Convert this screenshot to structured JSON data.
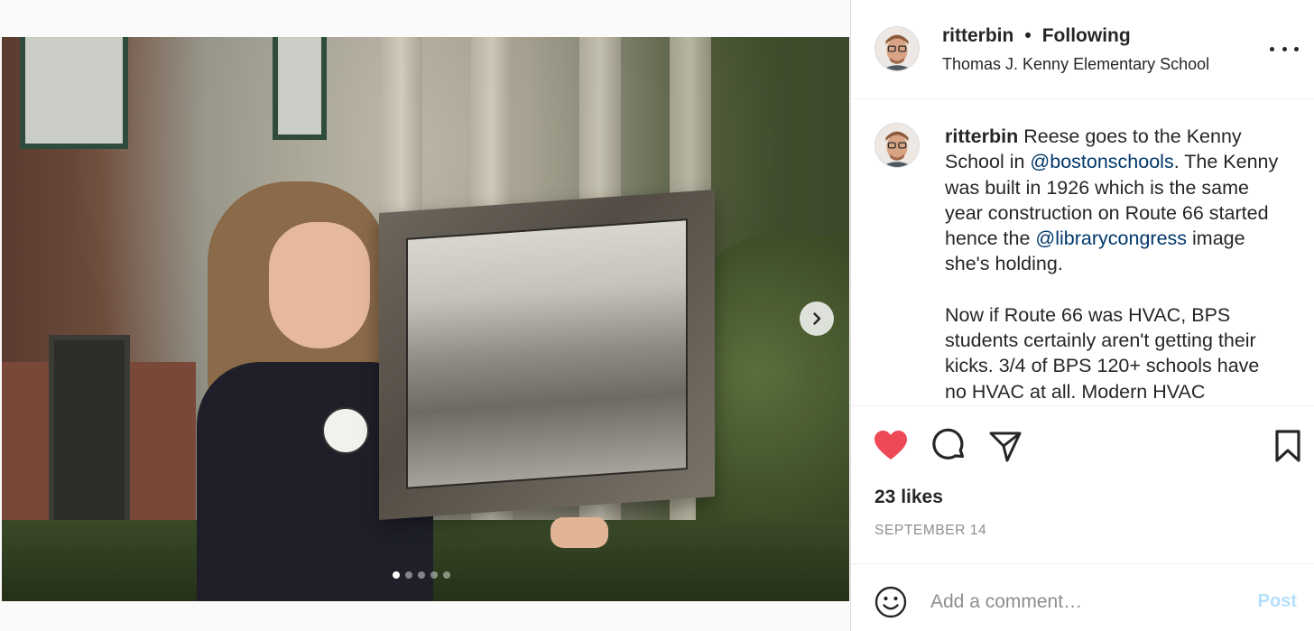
{
  "post": {
    "username": "ritterbin",
    "separator": "•",
    "follow_status": "Following",
    "location": "Thomas J. Kenny Elementary School",
    "caption": {
      "username": "ritterbin",
      "p1_a": " Reese goes to the Kenny School in ",
      "mention1": "@bostonschools",
      "p1_b": ". The Kenny was built in 1926 which is the same year construction on Route 66 started hence the ",
      "mention2": "@librarycongress",
      "p1_c": " image she's holding.",
      "p2": "Now if Route 66 was HVAC, BPS students certainly aren't getting their kicks. 3/4 of BPS 120+ schools have no HVAC at all. Modern HVAC"
    },
    "likes": "23 likes",
    "date": "SEPTEMBER 14",
    "comment_placeholder": "Add a comment…",
    "post_label": "Post"
  },
  "carousel": {
    "total": 5,
    "current": 1
  },
  "icons": {
    "like": "heart-icon",
    "comment": "comment-icon",
    "share": "paper-plane-icon",
    "save": "bookmark-icon",
    "more": "more-options-icon",
    "next": "chevron-right-icon",
    "emoji": "emoji-icon"
  },
  "colors": {
    "like_active": "#ed4956",
    "mention": "#00376b",
    "post_disabled": "#b2dffc",
    "meta_gray": "#8e8e8e"
  }
}
